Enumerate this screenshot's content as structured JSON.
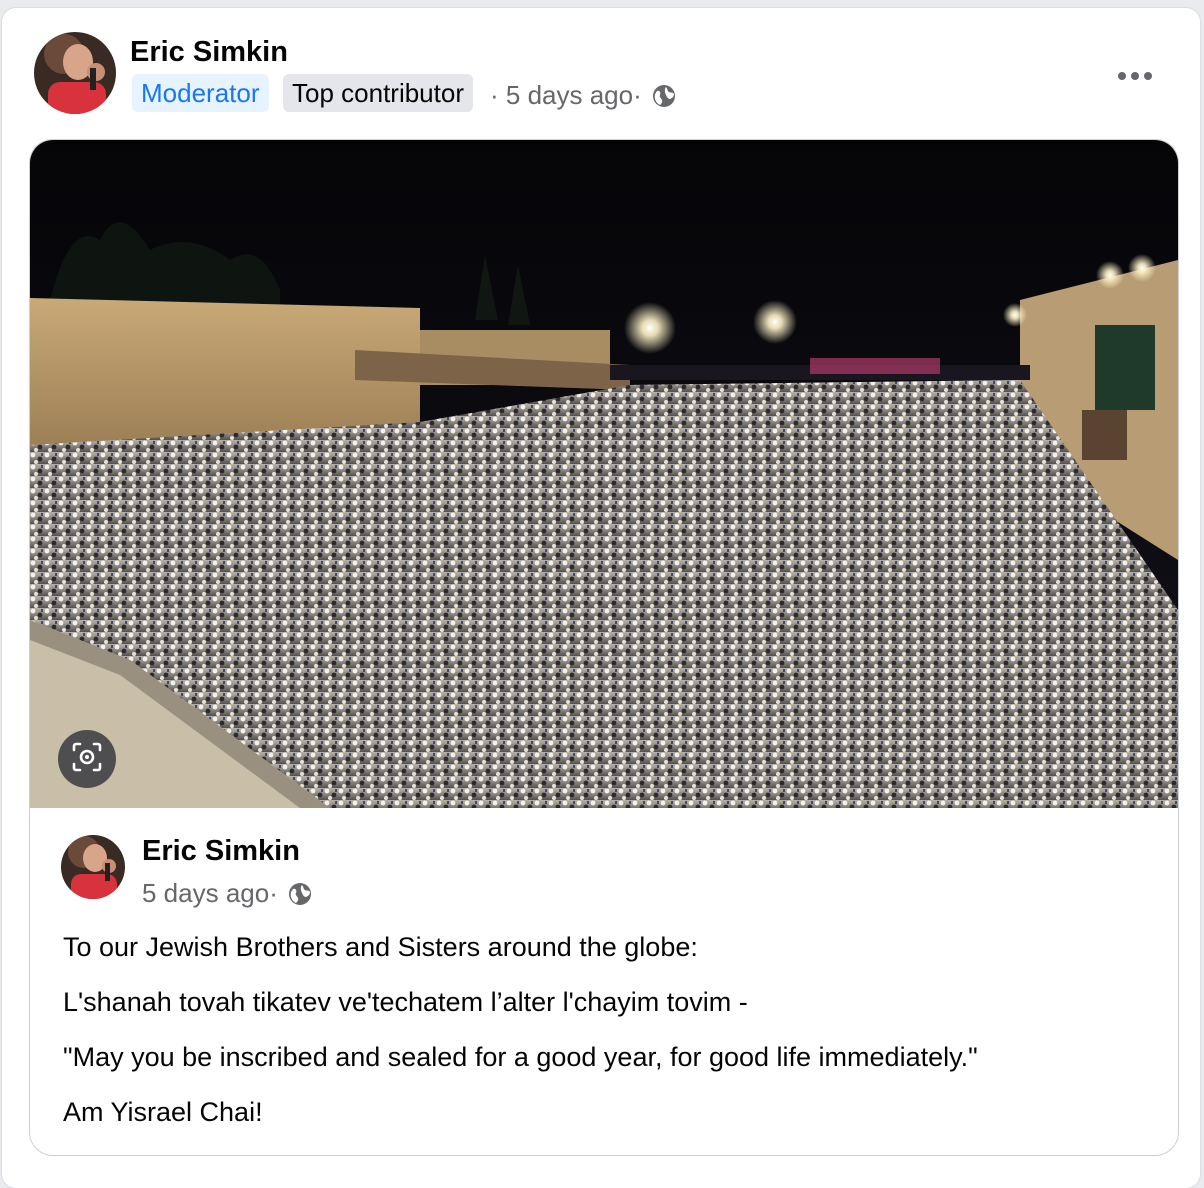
{
  "post": {
    "author": "Eric Simkin",
    "badges": {
      "moderator": "Moderator",
      "top_contributor": "Top contributor"
    },
    "time": "5 days ago",
    "privacy_icon": "globe-icon",
    "more_icon": "more-options-icon"
  },
  "shared_post": {
    "author": "Eric Simkin",
    "time": "5 days ago",
    "privacy_icon": "globe-icon",
    "image_icon": "visual-search-icon",
    "text_lines": [
      "To our Jewish Brothers and Sisters around the globe:",
      "L'shanah tovah tikatev ve'techatem l’alter l'chayim tovim -",
      "\"May you be inscribed and sealed for a good year, for good life immediately.\"",
      "Am Yisrael Chai!"
    ]
  },
  "colors": {
    "accent": "#1877f2",
    "moderator_badge_bg": "#e7f3ff",
    "top_contributor_badge_bg": "#e4e6eb",
    "meta_text": "#65676b",
    "border": "#ccd0d5"
  }
}
